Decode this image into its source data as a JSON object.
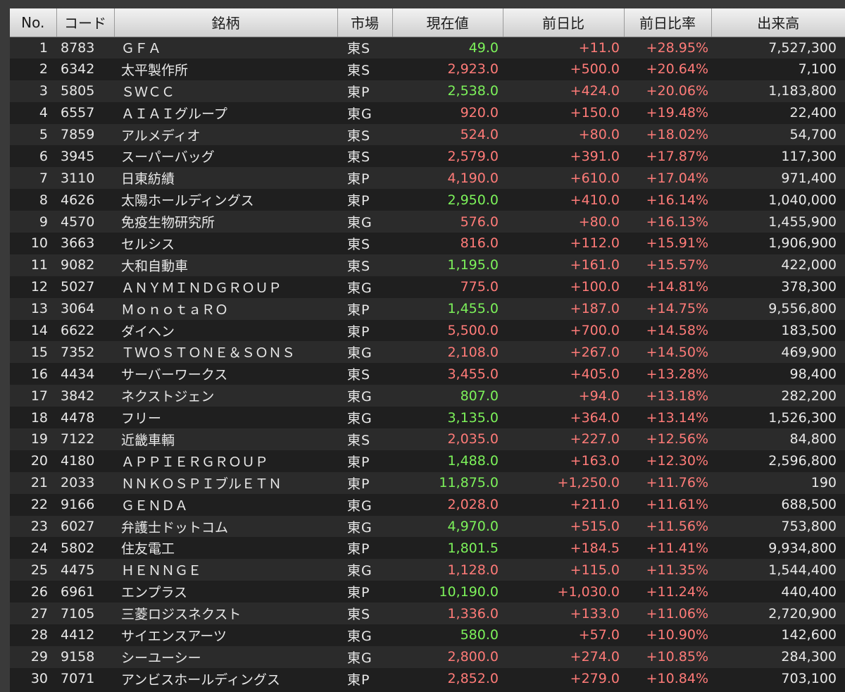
{
  "header": {
    "no": "No.",
    "code": "コード",
    "name": "銘柄",
    "market": "市場",
    "price": "現在値",
    "change": "前日比",
    "change_pct": "前日比率",
    "volume": "出来高"
  },
  "colors": {
    "price_green": "#7cf25a",
    "price_red": "#ff7b78",
    "change_red": "#ff7b78"
  },
  "rows": [
    {
      "no": "1",
      "code": "8783",
      "name": "ＧＦＡ",
      "market": "東S",
      "price": "49.0",
      "price_color": "green",
      "change": "+11.0",
      "change_pct": "+28.95%",
      "volume": "7,527,300"
    },
    {
      "no": "2",
      "code": "6342",
      "name": "太平製作所",
      "market": "東S",
      "price": "2,923.0",
      "price_color": "red",
      "change": "+500.0",
      "change_pct": "+20.64%",
      "volume": "7,100"
    },
    {
      "no": "3",
      "code": "5805",
      "name": "ＳＷＣＣ",
      "market": "東P",
      "price": "2,538.0",
      "price_color": "green",
      "change": "+424.0",
      "change_pct": "+20.06%",
      "volume": "1,183,800"
    },
    {
      "no": "4",
      "code": "6557",
      "name": "ＡＩＡＩグループ",
      "market": "東G",
      "price": "920.0",
      "price_color": "red",
      "change": "+150.0",
      "change_pct": "+19.48%",
      "volume": "22,400"
    },
    {
      "no": "5",
      "code": "7859",
      "name": "アルメディオ",
      "market": "東S",
      "price": "524.0",
      "price_color": "red",
      "change": "+80.0",
      "change_pct": "+18.02%",
      "volume": "54,700"
    },
    {
      "no": "6",
      "code": "3945",
      "name": "スーパーバッグ",
      "market": "東S",
      "price": "2,579.0",
      "price_color": "red",
      "change": "+391.0",
      "change_pct": "+17.87%",
      "volume": "117,300"
    },
    {
      "no": "7",
      "code": "3110",
      "name": "日東紡績",
      "market": "東P",
      "price": "4,190.0",
      "price_color": "red",
      "change": "+610.0",
      "change_pct": "+17.04%",
      "volume": "971,400"
    },
    {
      "no": "8",
      "code": "4626",
      "name": "太陽ホールディングス",
      "market": "東P",
      "price": "2,950.0",
      "price_color": "green",
      "change": "+410.0",
      "change_pct": "+16.14%",
      "volume": "1,040,000"
    },
    {
      "no": "9",
      "code": "4570",
      "name": "免疫生物研究所",
      "market": "東G",
      "price": "576.0",
      "price_color": "red",
      "change": "+80.0",
      "change_pct": "+16.13%",
      "volume": "1,455,900"
    },
    {
      "no": "10",
      "code": "3663",
      "name": "セルシス",
      "market": "東S",
      "price": "816.0",
      "price_color": "red",
      "change": "+112.0",
      "change_pct": "+15.91%",
      "volume": "1,906,900"
    },
    {
      "no": "11",
      "code": "9082",
      "name": "大和自動車",
      "market": "東S",
      "price": "1,195.0",
      "price_color": "green",
      "change": "+161.0",
      "change_pct": "+15.57%",
      "volume": "422,000"
    },
    {
      "no": "12",
      "code": "5027",
      "name": "ＡＮＹＭＩＮＤＧＲＯＵＰ",
      "market": "東G",
      "price": "775.0",
      "price_color": "red",
      "change": "+100.0",
      "change_pct": "+14.81%",
      "volume": "378,300"
    },
    {
      "no": "13",
      "code": "3064",
      "name": "ＭｏｎｏｔａＲＯ",
      "market": "東P",
      "price": "1,455.0",
      "price_color": "green",
      "change": "+187.0",
      "change_pct": "+14.75%",
      "volume": "9,556,800"
    },
    {
      "no": "14",
      "code": "6622",
      "name": "ダイヘン",
      "market": "東P",
      "price": "5,500.0",
      "price_color": "red",
      "change": "+700.0",
      "change_pct": "+14.58%",
      "volume": "183,500"
    },
    {
      "no": "15",
      "code": "7352",
      "name": "ＴＷＯＳＴＯＮＥ＆ＳＯＮＳ",
      "market": "東G",
      "price": "2,108.0",
      "price_color": "red",
      "change": "+267.0",
      "change_pct": "+14.50%",
      "volume": "469,900"
    },
    {
      "no": "16",
      "code": "4434",
      "name": "サーバーワークス",
      "market": "東S",
      "price": "3,455.0",
      "price_color": "red",
      "change": "+405.0",
      "change_pct": "+13.28%",
      "volume": "98,400"
    },
    {
      "no": "17",
      "code": "3842",
      "name": "ネクストジェン",
      "market": "東G",
      "price": "807.0",
      "price_color": "green",
      "change": "+94.0",
      "change_pct": "+13.18%",
      "volume": "282,200"
    },
    {
      "no": "18",
      "code": "4478",
      "name": "フリー",
      "market": "東G",
      "price": "3,135.0",
      "price_color": "green",
      "change": "+364.0",
      "change_pct": "+13.14%",
      "volume": "1,526,300"
    },
    {
      "no": "19",
      "code": "7122",
      "name": "近畿車輌",
      "market": "東S",
      "price": "2,035.0",
      "price_color": "red",
      "change": "+227.0",
      "change_pct": "+12.56%",
      "volume": "84,800"
    },
    {
      "no": "20",
      "code": "4180",
      "name": "ＡＰＰＩＥＲＧＲＯＵＰ",
      "market": "東P",
      "price": "1,488.0",
      "price_color": "green",
      "change": "+163.0",
      "change_pct": "+12.30%",
      "volume": "2,596,800"
    },
    {
      "no": "21",
      "code": "2033",
      "name": "ＮＮＫＯＳＰＩブルＥＴＮ",
      "market": "東P",
      "price": "11,875.0",
      "price_color": "green",
      "change": "+1,250.0",
      "change_pct": "+11.76%",
      "volume": "190"
    },
    {
      "no": "22",
      "code": "9166",
      "name": "ＧＥＮＤＡ",
      "market": "東G",
      "price": "2,028.0",
      "price_color": "red",
      "change": "+211.0",
      "change_pct": "+11.61%",
      "volume": "688,500"
    },
    {
      "no": "23",
      "code": "6027",
      "name": "弁護士ドットコム",
      "market": "東G",
      "price": "4,970.0",
      "price_color": "green",
      "change": "+515.0",
      "change_pct": "+11.56%",
      "volume": "753,800"
    },
    {
      "no": "24",
      "code": "5802",
      "name": "住友電工",
      "market": "東P",
      "price": "1,801.5",
      "price_color": "green",
      "change": "+184.5",
      "change_pct": "+11.41%",
      "volume": "9,934,800"
    },
    {
      "no": "25",
      "code": "4475",
      "name": "ＨＥＮＮＧＥ",
      "market": "東G",
      "price": "1,128.0",
      "price_color": "red",
      "change": "+115.0",
      "change_pct": "+11.35%",
      "volume": "1,544,400"
    },
    {
      "no": "26",
      "code": "6961",
      "name": "エンプラス",
      "market": "東P",
      "price": "10,190.0",
      "price_color": "green",
      "change": "+1,030.0",
      "change_pct": "+11.24%",
      "volume": "440,400"
    },
    {
      "no": "27",
      "code": "7105",
      "name": "三菱ロジスネクスト",
      "market": "東S",
      "price": "1,336.0",
      "price_color": "red",
      "change": "+133.0",
      "change_pct": "+11.06%",
      "volume": "2,720,900"
    },
    {
      "no": "28",
      "code": "4412",
      "name": "サイエンスアーツ",
      "market": "東G",
      "price": "580.0",
      "price_color": "green",
      "change": "+57.0",
      "change_pct": "+10.90%",
      "volume": "142,600"
    },
    {
      "no": "29",
      "code": "9158",
      "name": "シーユーシー",
      "market": "東G",
      "price": "2,800.0",
      "price_color": "red",
      "change": "+274.0",
      "change_pct": "+10.85%",
      "volume": "284,300"
    },
    {
      "no": "30",
      "code": "7071",
      "name": "アンビスホールディングス",
      "market": "東P",
      "price": "2,852.0",
      "price_color": "red",
      "change": "+279.0",
      "change_pct": "+10.84%",
      "volume": "703,100"
    }
  ]
}
